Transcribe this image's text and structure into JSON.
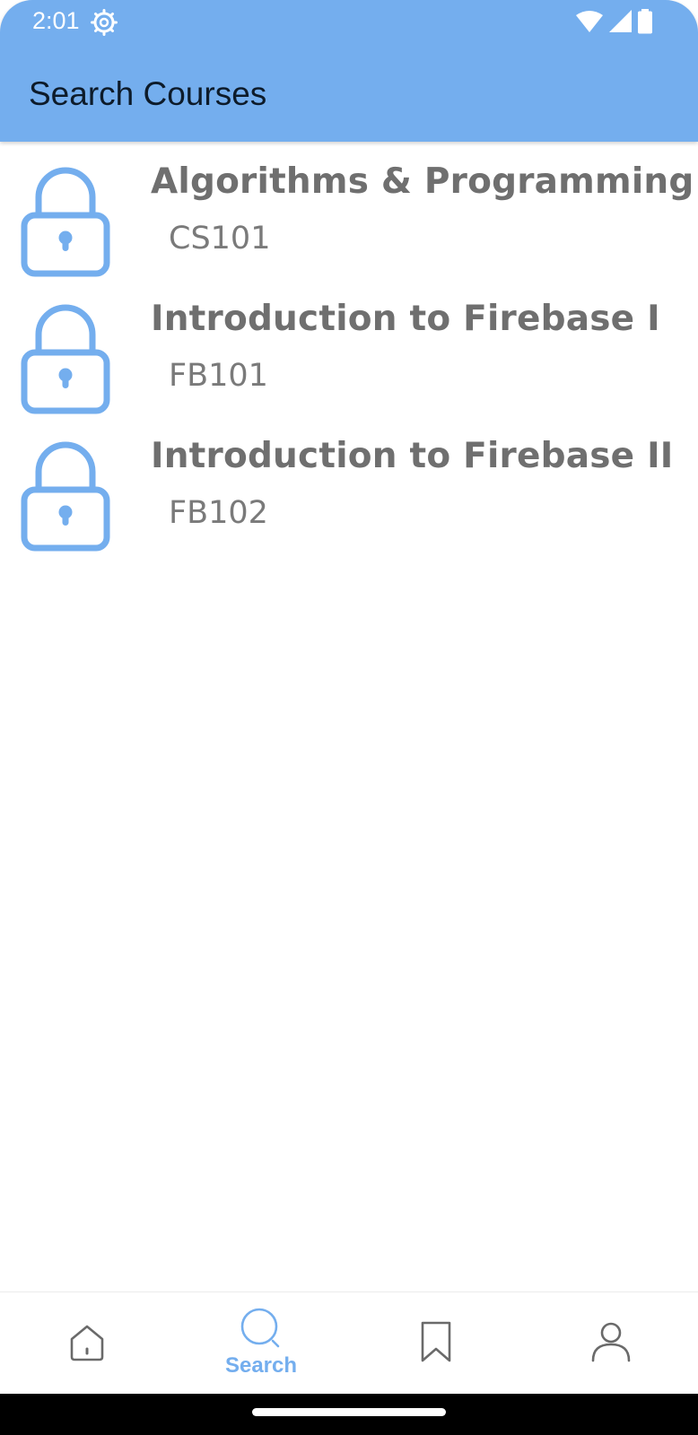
{
  "theme": {
    "accent": "#74AEEE",
    "icon_gray": "#6a6a6a"
  },
  "status_bar": {
    "time": "2:01",
    "icons": [
      "gear-icon",
      "wifi-icon",
      "cellular-signal-icon",
      "battery-icon"
    ]
  },
  "app_bar": {
    "title": "Search Courses"
  },
  "courses": [
    {
      "name": "Algorithms & Programming I",
      "code": "CS101",
      "icon": "lock-icon"
    },
    {
      "name": "Introduction to Firebase I",
      "code": "FB101",
      "icon": "lock-icon"
    },
    {
      "name": "Introduction to Firebase II",
      "code": "FB102",
      "icon": "lock-icon"
    }
  ],
  "bottom_nav": {
    "items": [
      {
        "icon": "home-icon",
        "label": "",
        "active": false
      },
      {
        "icon": "search-icon",
        "label": "Search",
        "active": true
      },
      {
        "icon": "bookmark-icon",
        "label": "",
        "active": false
      },
      {
        "icon": "profile-icon",
        "label": "",
        "active": false
      }
    ]
  }
}
